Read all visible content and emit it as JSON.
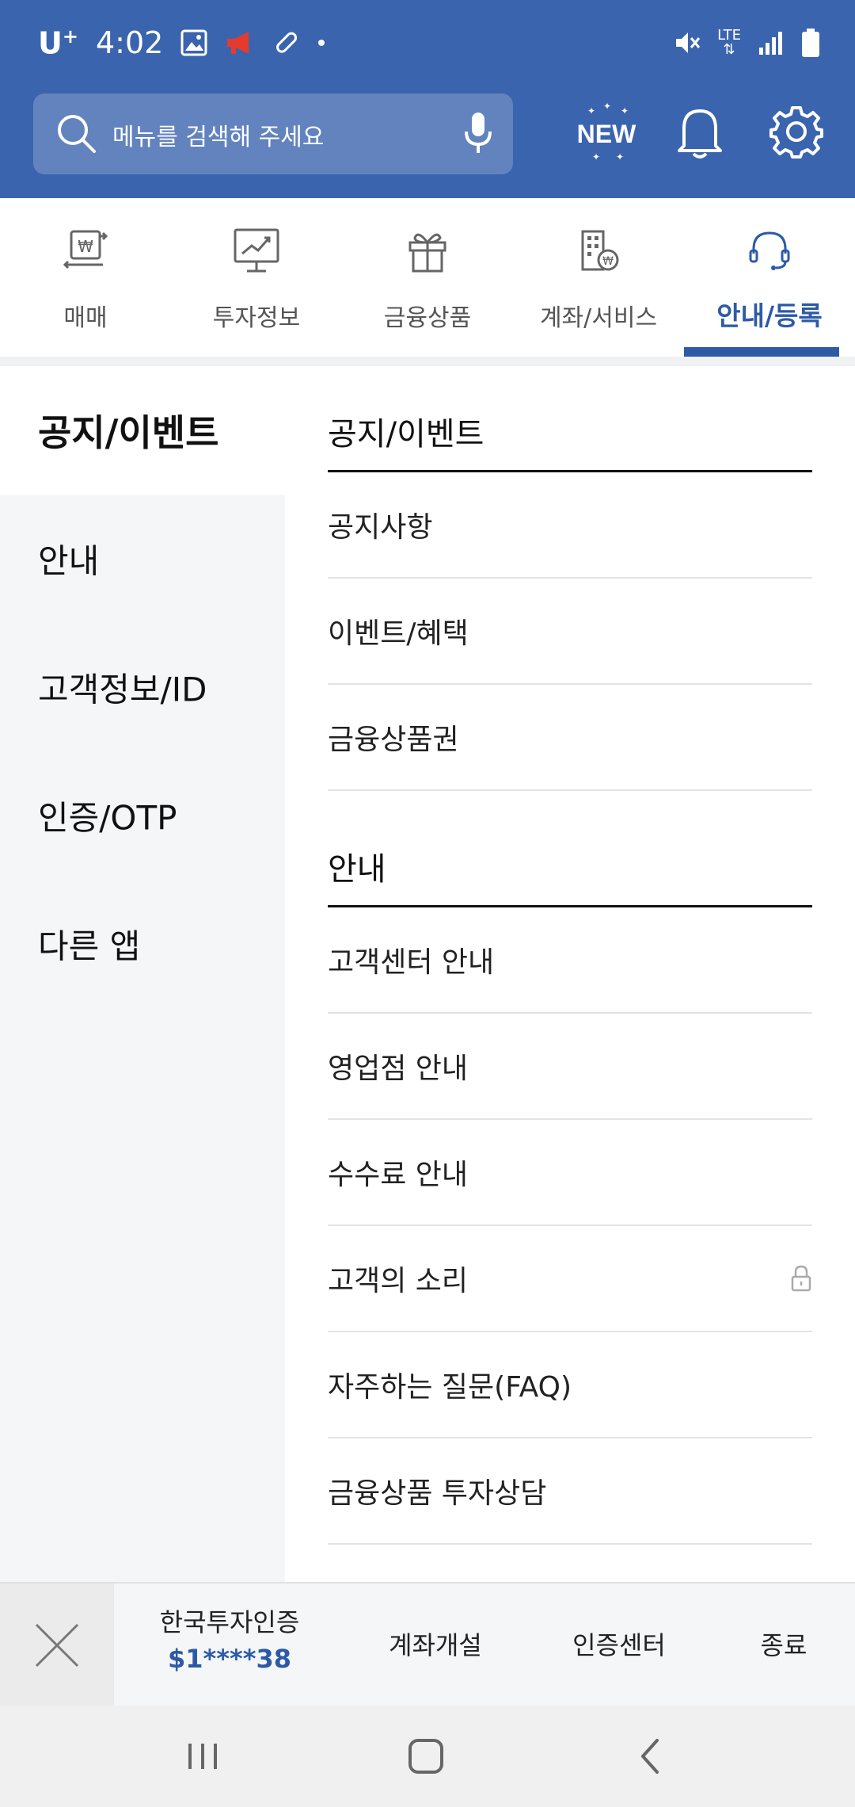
{
  "status_bar": {
    "carrier": "U",
    "carrier_plus": "+",
    "time": "4:02",
    "network": "LTE"
  },
  "search": {
    "placeholder": "메뉴를 검색해 주세요"
  },
  "header_icons": [
    "new-badge-icon",
    "bell-icon",
    "gear-icon"
  ],
  "new_badge": "NEW",
  "tabs": [
    {
      "label": "매매",
      "icon": "trade-icon"
    },
    {
      "label": "투자정보",
      "icon": "chart-monitor-icon"
    },
    {
      "label": "금융상품",
      "icon": "gift-icon"
    },
    {
      "label": "계좌/서비스",
      "icon": "building-won-icon"
    },
    {
      "label": "안내/등록",
      "icon": "headset-icon",
      "active": true
    }
  ],
  "left_menu": [
    {
      "label": "공지/이벤트",
      "active": true
    },
    {
      "label": "안내"
    },
    {
      "label": "고객정보/ID"
    },
    {
      "label": "인증/OTP"
    },
    {
      "label": "다른 앱"
    }
  ],
  "sections": [
    {
      "title": "공지/이벤트",
      "items": [
        "공지사항",
        "이벤트/혜택",
        "금융상품권"
      ]
    },
    {
      "title": "안내",
      "items": [
        "고객센터 안내",
        "영업점 안내",
        "수수료 안내",
        "고객의 소리",
        "자주하는 질문(FAQ)",
        "금융상품 투자상담"
      ]
    }
  ],
  "quick_bar": {
    "auth_title": "한국투자인증",
    "auth_id": "$1****38",
    "open_account": "계좌개설",
    "cert_center": "인증센터",
    "exit": "종료"
  },
  "colors": {
    "brand": "#3b64ae",
    "accent": "#2d5aa6"
  }
}
